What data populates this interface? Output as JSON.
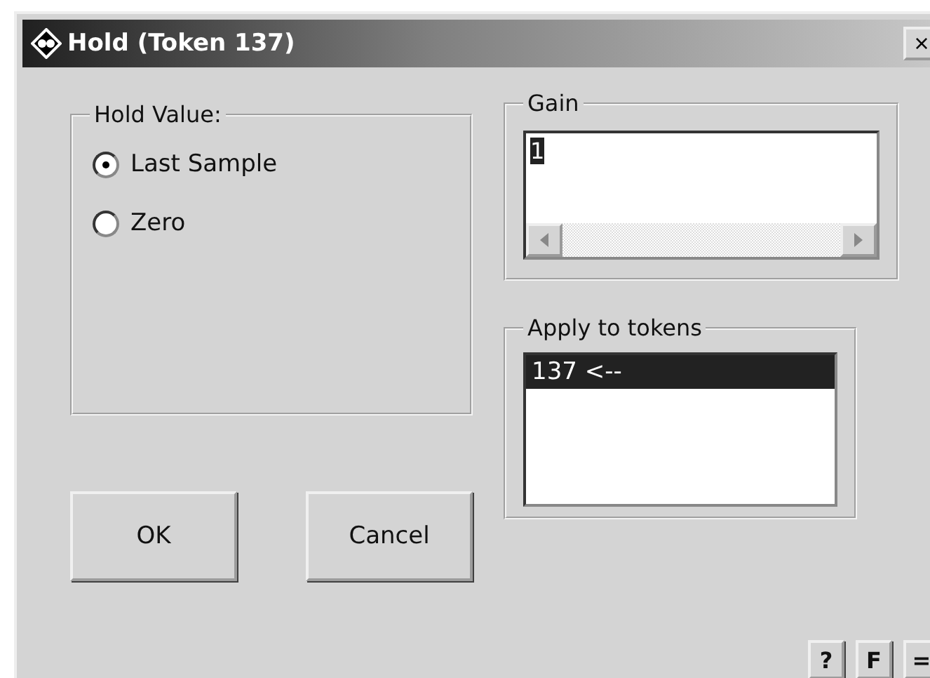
{
  "window": {
    "title": "Hold (Token 137)",
    "close": "×"
  },
  "hold_value": {
    "legend": "Hold Value:",
    "options": [
      {
        "label": "Last Sample",
        "selected": true
      },
      {
        "label": "Zero",
        "selected": false
      }
    ]
  },
  "gain": {
    "legend": "Gain",
    "value": "1"
  },
  "apply_to_tokens": {
    "legend": "Apply to tokens",
    "items": [
      {
        "label": "137 <--",
        "selected": true
      }
    ]
  },
  "buttons": [
    "OK",
    "Cancel"
  ],
  "tool_buttons": [
    "?",
    "F",
    "="
  ]
}
